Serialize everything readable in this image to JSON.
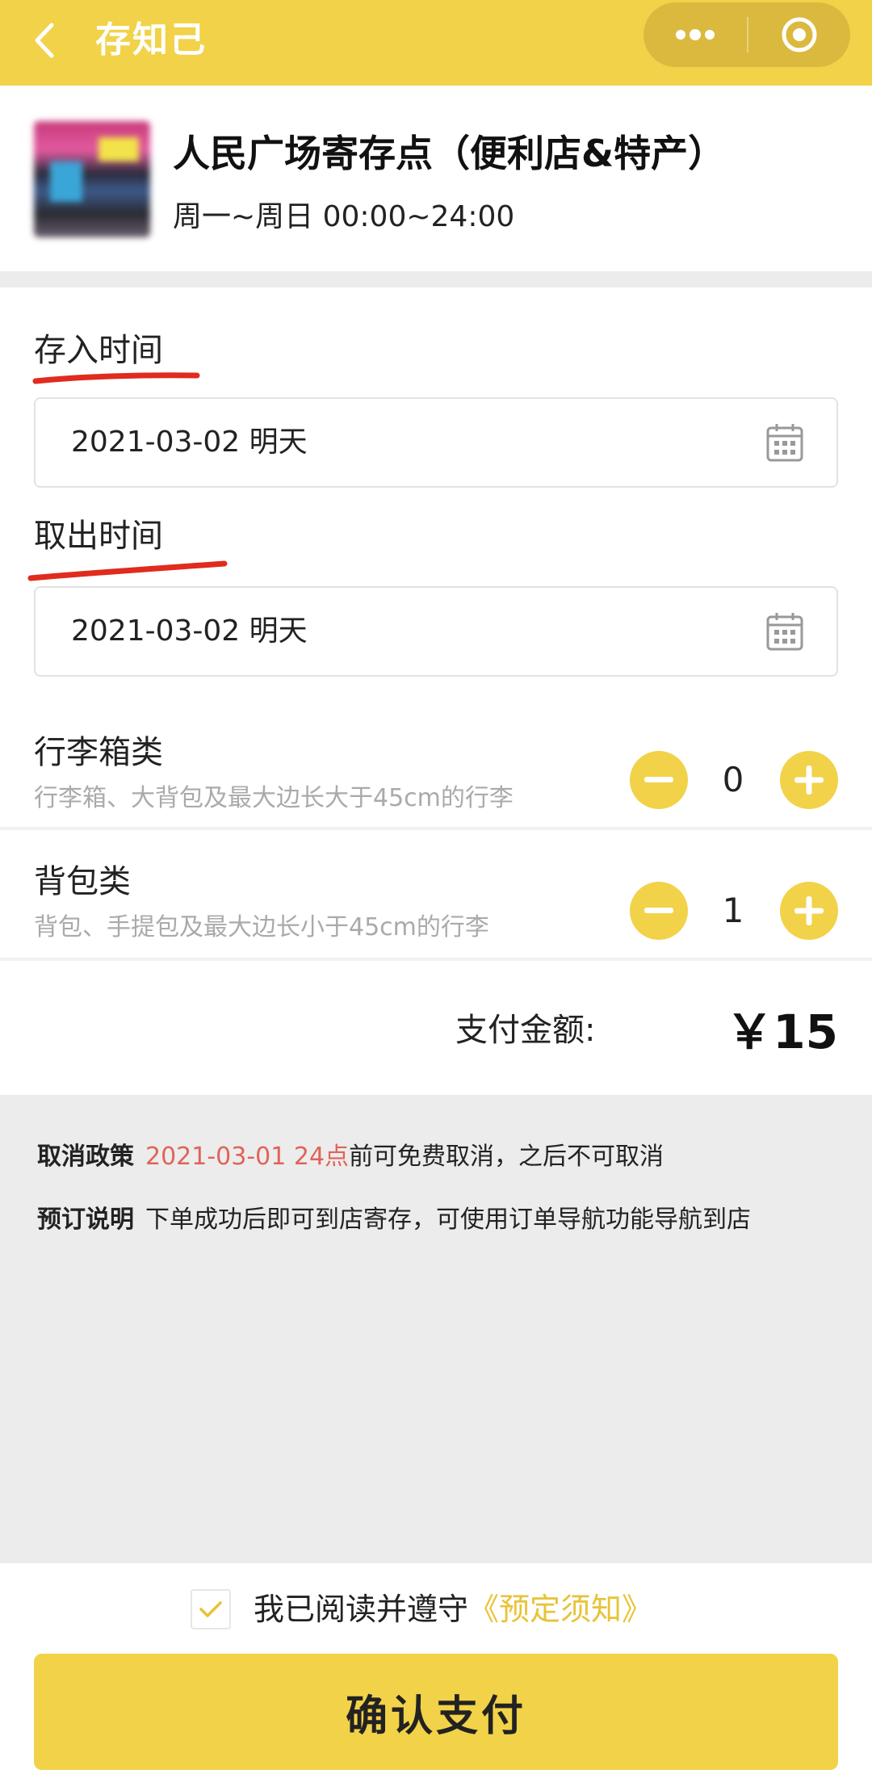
{
  "header": {
    "title": "存知己"
  },
  "store": {
    "name": "人民广场寄存点（便利店&特产）",
    "hours": "周一~周日 00:00~24:00"
  },
  "form": {
    "checkin_label": "存入时间",
    "checkin_value": "2021-03-02 明天",
    "checkout_label": "取出时间",
    "checkout_value": "2021-03-02 明天"
  },
  "luggage": [
    {
      "title": "行李箱类",
      "desc": "行李箱、大背包及最大边长大于45cm的行李",
      "count": "0"
    },
    {
      "title": "背包类",
      "desc": "背包、手提包及最大边长小于45cm的行李",
      "count": "1"
    }
  ],
  "payment": {
    "label": "支付金额:",
    "amount": "￥15"
  },
  "policy": {
    "cancel_key": "取消政策",
    "cancel_date": "2021-03-01 24点",
    "cancel_text": "前可免费取消，之后不可取消",
    "booking_key": "预订说明",
    "booking_text": "下单成功后即可到店寄存，可使用订单导航功能导航到店"
  },
  "agreement": {
    "checked": true,
    "text": "我已阅读并遵守",
    "link": "《预定须知》"
  },
  "confirm_label": "确认支付",
  "colors": {
    "brand_yellow": "#f2d248",
    "capsule": "#dbb93e",
    "annotation_red": "#e02b1e",
    "policy_red": "#e0635a",
    "link_yellow": "#e8c337"
  }
}
